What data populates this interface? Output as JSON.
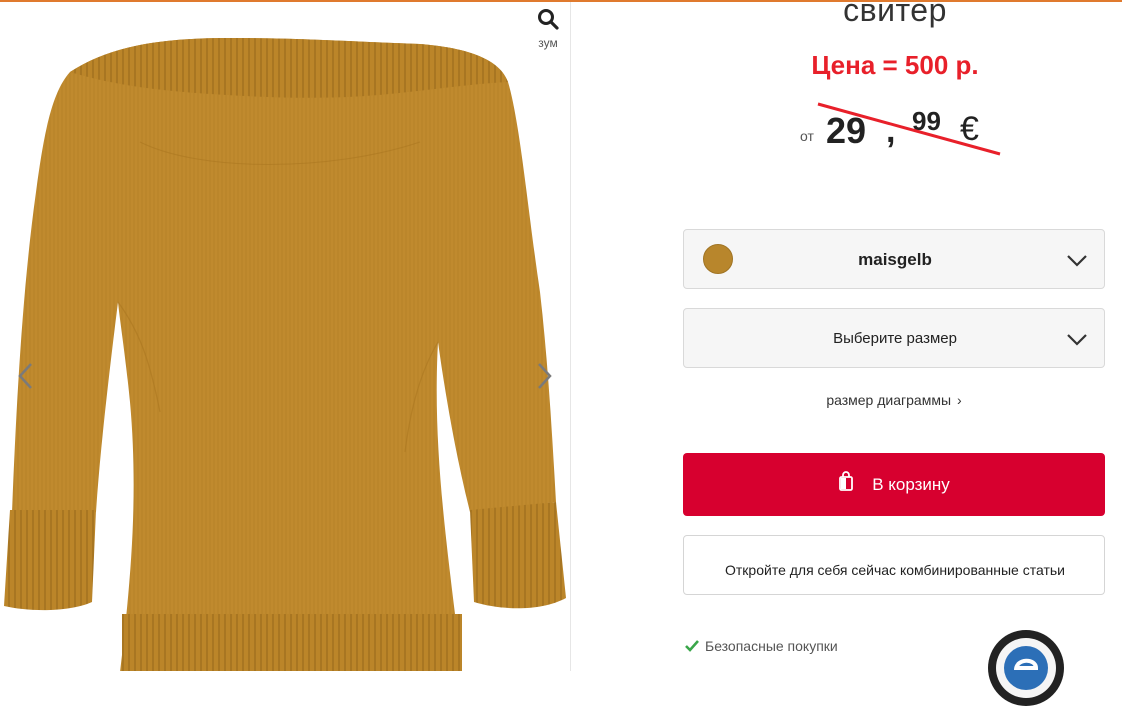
{
  "product": {
    "title": "свитер",
    "promo_price": "Цена = 500 р.",
    "old_price": {
      "from": "от",
      "euros": "29",
      "comma": ",",
      "cents": "99",
      "currency": "€"
    }
  },
  "gallery": {
    "zoom_label": "зум",
    "zoom_icon": "search-icon",
    "prev_icon": "chevron-left-icon",
    "next_icon": "chevron-right-icon",
    "product_color": "#c08a2e"
  },
  "options": {
    "color_value": "maisgelb",
    "color_swatch": "#b8862c",
    "size_placeholder": "Выберите размер"
  },
  "size_chart_link": "размер диаграммы",
  "size_chart_caret": "›",
  "cart_button": {
    "label": "В корзину",
    "color": "#d7002f"
  },
  "combo_button": {
    "label": "Откройте для себя сейчас комбинированные статьи"
  },
  "secure_purchase": "Безопасные покупки",
  "accent_colors": {
    "top_line": "#e07a2e",
    "strike": "#e8202a"
  }
}
